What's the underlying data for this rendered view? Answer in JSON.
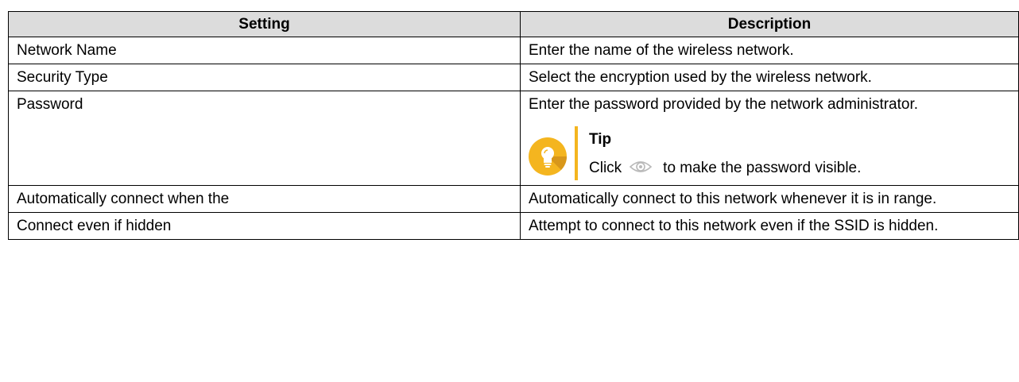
{
  "table": {
    "headers": {
      "setting": "Setting",
      "description": "Description"
    },
    "rows": [
      {
        "setting": "Network Name",
        "description": "Enter the name of the wireless network."
      },
      {
        "setting": "Security Type",
        "description": "Select the encryption used by the wireless network."
      },
      {
        "setting": "Password",
        "description": "Enter the password provided by the network administrator."
      },
      {
        "setting": "Automatically connect when the",
        "description": "Automatically connect to this network whenever it is in range."
      },
      {
        "setting": "Connect even if hidden",
        "description": "Attempt to connect to this network even if the SSID is hidden."
      }
    ]
  },
  "tip": {
    "title": "Tip",
    "text_before": "Click",
    "text_after": "to make the password visible.",
    "icon": "lightbulb-icon",
    "inline_icon": "eye-icon"
  },
  "colors": {
    "header_bg": "#dcdcdc",
    "border": "#000000",
    "tip_accent": "#f4b51f",
    "eye_icon": "#b9b9b9"
  }
}
